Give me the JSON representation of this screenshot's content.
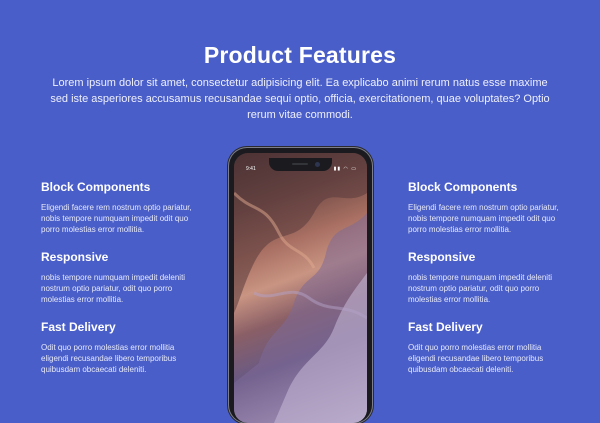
{
  "header": {
    "title": "Product Features",
    "intro": "Lorem ipsum dolor sit amet, consectetur adipisicing elit. Ea explicabo animi rerum natus esse maxime sed iste asperiores accusamus recusandae sequi optio, officia, exercitationem, quae voluptates? Optio rerum vitae commodi."
  },
  "left_features": [
    {
      "title": "Block Components",
      "text": "Eligendi facere rem nostrum optio pariatur, nobis tempore numquam impedit odit quo porro molestias error mollitia."
    },
    {
      "title": "Responsive",
      "text": "nobis tempore numquam impedit deleniti nostrum optio pariatur, odit quo porro molestias error mollitia."
    },
    {
      "title": "Fast Delivery",
      "text": "Odit quo porro molestias error mollitia eligendi recusandae libero temporibus quibusdam obcaecati deleniti."
    }
  ],
  "right_features": [
    {
      "title": "Block Components",
      "text": "Eligendi facere rem nostrum optio pariatur, nobis tempore numquam impedit odit quo porro molestias error mollitia."
    },
    {
      "title": "Responsive",
      "text": "nobis tempore numquam impedit deleniti nostrum optio pariatur, odit quo porro molestias error mollitia."
    },
    {
      "title": "Fast Delivery",
      "text": "Odit quo porro molestias error mollitia eligendi recusandae libero temporibus quibusdam obcaecati deleniti."
    }
  ],
  "phone": {
    "time": "9:41",
    "status_icons": "▮▮ ◠ ▭",
    "image_icon": "canyon-photo"
  },
  "colors": {
    "background": "#4a5ec9",
    "text": "#ffffff"
  }
}
